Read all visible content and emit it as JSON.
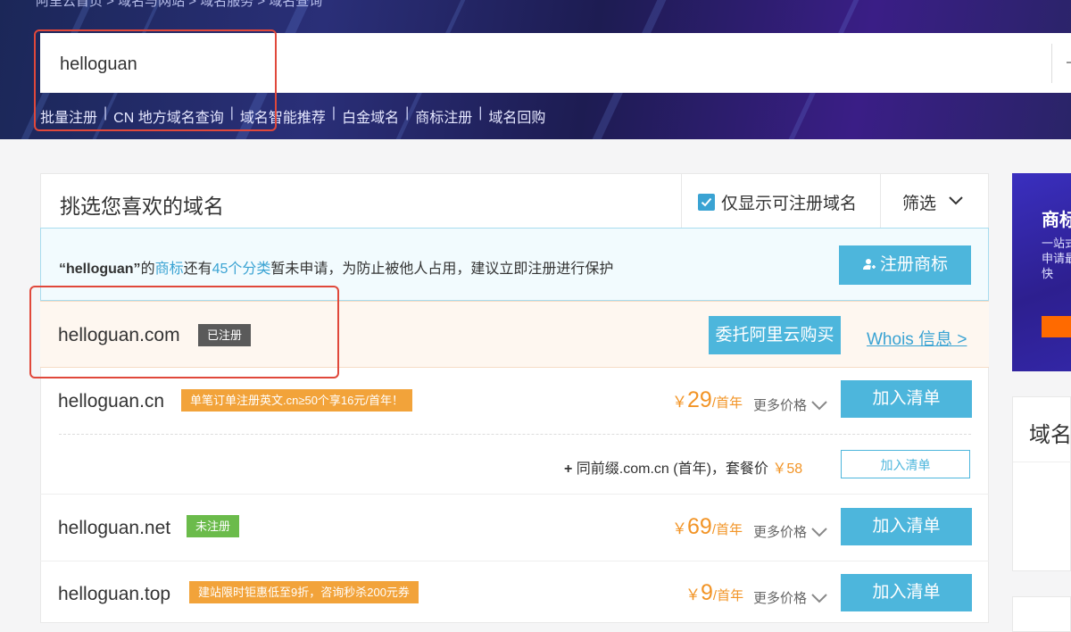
{
  "breadcrumb": "阿里云首页 > 域名与网站 > 域名服务 > 域名查询",
  "search": {
    "value": "helloguan"
  },
  "quick_links": [
    "批量注册",
    "CN 地方域名查询",
    "域名智能推荐",
    "白金域名",
    "商标注册",
    "域名回购"
  ],
  "panel": {
    "title": "挑选您喜欢的域名",
    "only_available_label": "仅显示可注册域名",
    "filter_label": "筛选"
  },
  "trademark": {
    "name": "“helloguan”",
    "t1": "的",
    "link": "商标",
    "t2": "还有",
    "count": "45个分类",
    "t3": "暂未申请，为防止被他人占用，建议立即注册进行保护",
    "button": "注册商标"
  },
  "registered": {
    "domain": "helloguan.com",
    "tag": "已注册",
    "proxy_button": "委托阿里云购买",
    "whois": "Whois 信息 >"
  },
  "rows": [
    {
      "domain": "helloguan.cn",
      "tag": "单笔订单注册英文.cn≥50个享16元/首年！",
      "price": "29",
      "yen": "￥",
      "unit": "/首年",
      "more": "更多价格",
      "button": "加入清单"
    },
    {
      "domain": "helloguan.net",
      "tag": "未注册",
      "price": "69",
      "yen": "￥",
      "unit": "/首年",
      "more": "更多价格",
      "button": "加入清单"
    },
    {
      "domain": "helloguan.top",
      "tag": "建站限时钜惠低至9折，咨询秒杀200元券",
      "price": "9",
      "yen": "￥",
      "unit": "/首年",
      "more": "更多价格",
      "button": "加入清单"
    }
  ],
  "bundle": {
    "plus": "+",
    "text": "同前缀.com.cn (首年)，套餐价",
    "price": "￥58",
    "button": "加入清单"
  },
  "ad": {
    "title": "商标",
    "text": "一站式申请最快"
  },
  "side": {
    "title": "域名"
  },
  "colors": {
    "accent": "#4db6dc",
    "price": "#f29426",
    "highlight_border": "#e0483b"
  }
}
